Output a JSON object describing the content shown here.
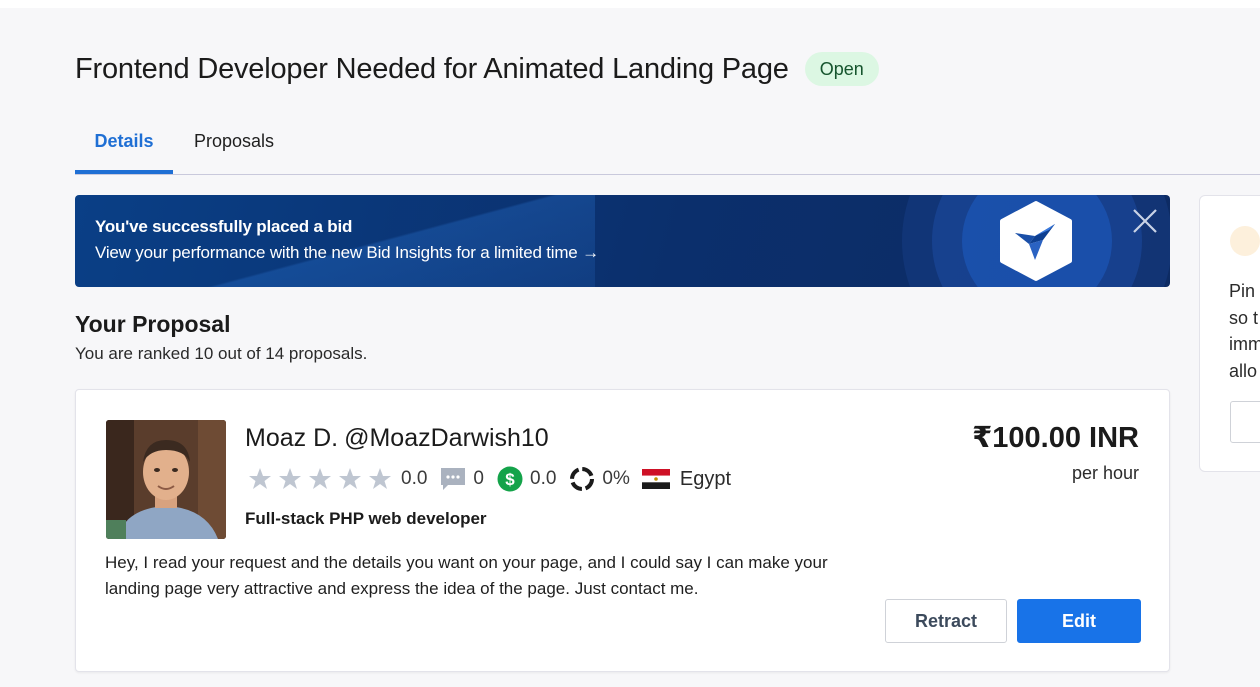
{
  "header": {
    "title": "Frontend Developer Needed for Animated Landing Page",
    "status": "Open"
  },
  "tabs": [
    {
      "label": "Details",
      "active": true
    },
    {
      "label": "Proposals",
      "active": false
    }
  ],
  "banner": {
    "title": "You've successfully placed a bid",
    "subtitle": "View your performance with the new Bid Insights for a limited time →",
    "logo_icon": "freelancer-bird-hex-icon",
    "close_icon": "close-icon"
  },
  "proposal_section": {
    "title": "Your Proposal",
    "rank_text": "You are ranked 10 out of 14 proposals."
  },
  "proposal_card": {
    "user_name": "Moaz D.",
    "handle": "@MoazDarwish10",
    "rating": "0.0",
    "stars_filled": 0,
    "stars_total": 5,
    "reviews": "0",
    "earnings": "0.0",
    "completion": "0%",
    "country": "Egypt",
    "tagline": "Full-stack PHP web developer",
    "text": "Hey, I read your request and the details you want on your page, and I could say I can make your landing page very attractive and express the idea of the page. Just contact me.",
    "price": "₹100.00 INR",
    "rate_unit": "per hour",
    "retract_label": "Retract",
    "edit_label": "Edit"
  },
  "side_panel": {
    "text": "Pin\nso t\nimm\nallo"
  },
  "colors": {
    "accent": "#1873e8",
    "banner_bg": "#0b2f6c",
    "status_bg": "#dcf7e3",
    "earnings_green": "#14a34a"
  }
}
